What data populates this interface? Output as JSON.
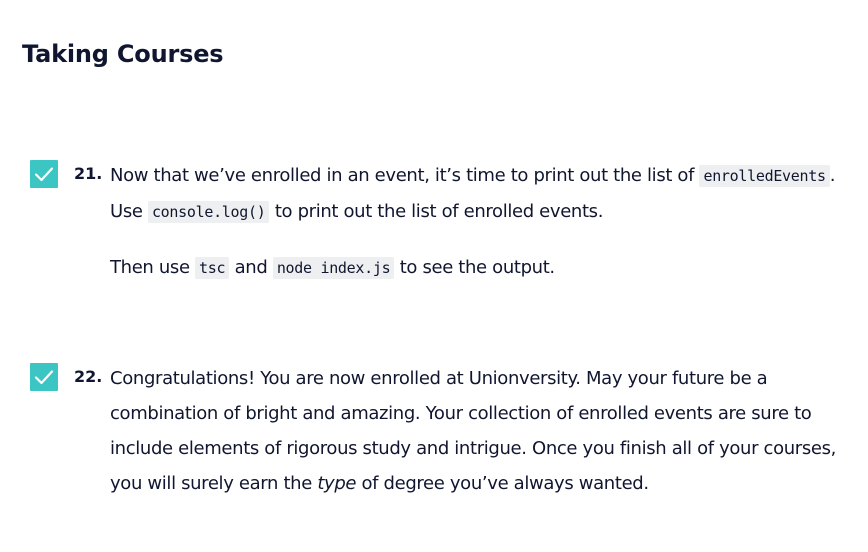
{
  "section": {
    "title": "Taking Courses"
  },
  "tasks": [
    {
      "number": "21.",
      "checked": true,
      "p1_text1": "Now that we’ve enrolled in an event, it’s time to print out the list of ",
      "p1_code1": "enrolledEvents",
      "p1_text2": ". Use ",
      "p1_code2": "console.log()",
      "p1_text3": " to print out the list of enrolled events.",
      "p2_text1": "Then use ",
      "p2_code1": "tsc",
      "p2_text2": " and ",
      "p2_code2": "node index.js",
      "p2_text3": " to see the output."
    },
    {
      "number": "22.",
      "checked": true,
      "text1": "Congratulations! You are now enrolled at Unionversity. May your future be a combination of bright and amazing. Your collection of enrolled events are sure to include elements of rigorous study and intrigue. Once you finish all of your courses, you will surely earn the ",
      "emphasis": "type",
      "text2": " of degree you’ve always wanted."
    }
  ],
  "colors": {
    "checkbox": "#3bc6c3",
    "text": "#10162f",
    "code_background": "#eeeff0"
  },
  "icons": {
    "checkbox": "checkmark-icon"
  }
}
